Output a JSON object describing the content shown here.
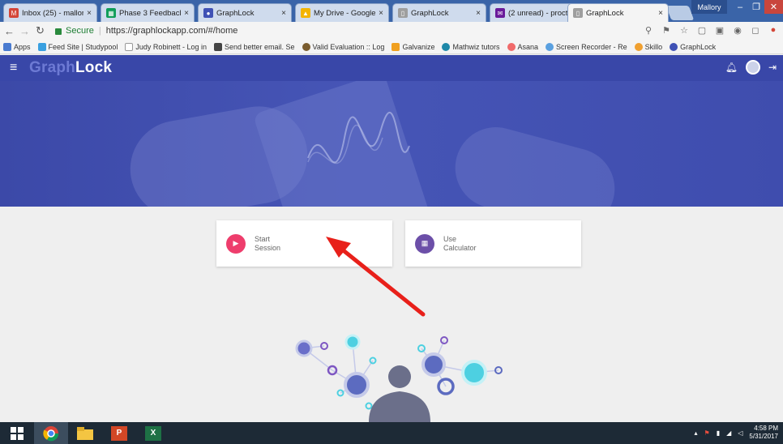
{
  "browser": {
    "tabs": [
      {
        "title": "Inbox (25) - mallor",
        "icon": "gmail-icon",
        "color": "#d44638"
      },
      {
        "title": "Phase 3 Feedback",
        "icon": "sheets-icon",
        "color": "#0f9d58"
      },
      {
        "title": "GraphLock",
        "icon": "graphlock-icon",
        "color": "#3f51b5"
      },
      {
        "title": "My Drive - Google",
        "icon": "drive-icon",
        "color": "#f4b400"
      },
      {
        "title": "GraphLock",
        "icon": "page-icon",
        "color": "#9e9e9e"
      },
      {
        "title": "(2 unread) - procto",
        "icon": "mail-icon",
        "color": "#6a1b9a"
      },
      {
        "title": "GraphLock",
        "icon": "page-icon",
        "color": "#9e9e9e"
      }
    ],
    "profile": "Mallory",
    "secure_label": "Secure",
    "separator": "|",
    "url": "https://graphlockapp.com/#/home",
    "bookmarks": [
      {
        "label": "Apps",
        "color": "#4a7bd0"
      },
      {
        "label": "Feed Site | Studypool",
        "color": "#3aa0e0"
      },
      {
        "label": "Judy Robinett - Log in",
        "color": "#9e9e9e"
      },
      {
        "label": "Send better email. Se",
        "color": "#444444"
      },
      {
        "label": "Valid Evaluation :: Log",
        "color": "#7a5c2e"
      },
      {
        "label": "Galvanize",
        "color": "#f0a020"
      },
      {
        "label": "Mathwiz tutors",
        "color": "#1e88a8"
      },
      {
        "label": "Asana",
        "color": "#f06a6a"
      },
      {
        "label": "Screen Recorder - Re",
        "color": "#5aa0e0"
      },
      {
        "label": "Skillo",
        "color": "#f0a030"
      },
      {
        "label": "GraphLock",
        "color": "#3f51b5"
      }
    ]
  },
  "app": {
    "logo_part1": "Graph",
    "logo_part2": "Lock",
    "cards": [
      {
        "line1": "Start",
        "line2": "Session",
        "icon": "play-icon",
        "color": "#ee3d6c"
      },
      {
        "line1": "Use",
        "line2": "Calculator",
        "icon": "calculator-icon",
        "color": "#6c4fa8"
      }
    ]
  },
  "taskbar": {
    "time": "4:58 PM",
    "date": "5/31/2017"
  },
  "colors": {
    "header": "#3947a8",
    "accent_arrow": "#e8201a"
  }
}
